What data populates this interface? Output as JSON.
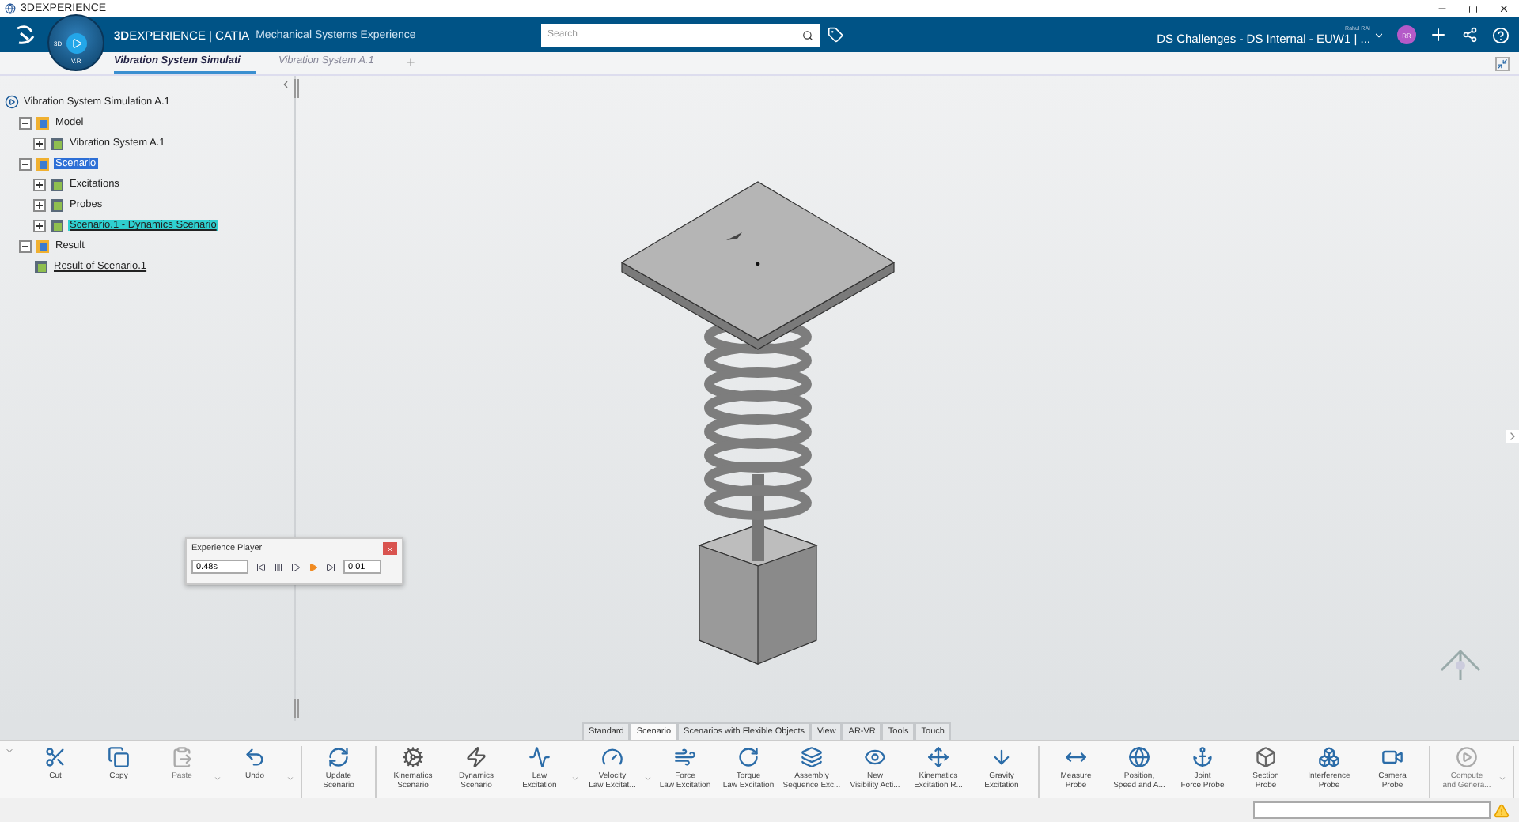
{
  "window": {
    "title": "3DEXPERIENCE"
  },
  "top_bar": {
    "compass_labels": [
      "3D",
      "V.R"
    ],
    "brand": "**3D**EXPERIENCE | CATIA",
    "app": "Mechanical Systems Experience",
    "search": {
      "placeholder": "Search"
    },
    "user": "Rahul RAI",
    "tenant": "DS Challenges - DS Internal - EUW1 | ...",
    "avatar": "RR"
  },
  "tabs": [
    {
      "label": "Vibration System Simulati",
      "selected": true
    },
    {
      "label": "Vibration System A.1",
      "selected": false
    }
  ],
  "tree": {
    "label": "Vibration System Simulation A.1",
    "selected": false,
    "current": false,
    "linked": false,
    "children": [
      {
        "label": "Model",
        "expanded": true,
        "selected": false,
        "current": false,
        "linked": false,
        "children": [
          {
            "label": "Vibration System A.1",
            "expanded": false,
            "selected": false,
            "current": false,
            "linked": false
          }
        ]
      },
      {
        "label": "Scenario",
        "expanded": true,
        "selected": true,
        "current": false,
        "linked": false,
        "children": [
          {
            "label": "Excitations",
            "expanded": false,
            "selected": false,
            "current": false,
            "linked": false
          },
          {
            "label": "Probes",
            "expanded": false,
            "selected": false,
            "current": false,
            "linked": false
          },
          {
            "label": "Scenario.1 - Dynamics Scenario",
            "expanded": false,
            "selected": false,
            "current": true,
            "linked": true
          }
        ]
      },
      {
        "label": "Result",
        "expanded": true,
        "selected": false,
        "current": false,
        "linked": false,
        "children": [
          {
            "label": "Result of Scenario.1",
            "selected": false,
            "current": false,
            "linked": true
          }
        ]
      }
    ]
  },
  "player": {
    "title": "Experience Player",
    "time": "0.48s",
    "step": "0.01"
  },
  "bottom_tabs": [
    {
      "label": "Standard",
      "selected": false
    },
    {
      "label": "Scenario",
      "selected": true
    },
    {
      "label": "Scenarios with Flexible Objects",
      "selected": false
    },
    {
      "label": "View",
      "selected": false
    },
    {
      "label": "AR-VR",
      "selected": false
    },
    {
      "label": "Tools",
      "selected": false
    },
    {
      "label": "Touch",
      "selected": false
    }
  ],
  "toolbar": [
    [
      {
        "lines": [
          "Cut"
        ],
        "disabled": false,
        "dropdown": false
      },
      {
        "lines": [
          "Copy"
        ],
        "disabled": false,
        "dropdown": false
      },
      {
        "lines": [
          "Paste"
        ],
        "disabled": true,
        "dropdown": true
      },
      {
        "lines": [
          "Undo"
        ],
        "disabled": false,
        "dropdown": true
      }
    ],
    [
      {
        "lines": [
          "Update",
          "Scenario"
        ],
        "disabled": false,
        "dropdown": false
      }
    ],
    [
      {
        "lines": [
          "Kinematics",
          "Scenario"
        ],
        "disabled": false,
        "dropdown": false
      },
      {
        "lines": [
          "Dynamics",
          "Scenario"
        ],
        "disabled": false,
        "dropdown": false
      },
      {
        "lines": [
          "Law",
          "Excitation"
        ],
        "disabled": false,
        "dropdown": true
      },
      {
        "lines": [
          "Velocity",
          "Law Excitat..."
        ],
        "disabled": false,
        "dropdown": true
      },
      {
        "lines": [
          "Force",
          "Law Excitation"
        ],
        "disabled": false,
        "dropdown": false
      },
      {
        "lines": [
          "Torque",
          "Law Excitation"
        ],
        "disabled": false,
        "dropdown": false
      },
      {
        "lines": [
          "Assembly",
          "Sequence Exc..."
        ],
        "disabled": false,
        "dropdown": false
      },
      {
        "lines": [
          "New",
          "Visibility Acti..."
        ],
        "disabled": false,
        "dropdown": false
      },
      {
        "lines": [
          "Kinematics",
          "Excitation R..."
        ],
        "disabled": false,
        "dropdown": false
      },
      {
        "lines": [
          "Gravity",
          "Excitation"
        ],
        "disabled": false,
        "dropdown": false
      }
    ],
    [
      {
        "lines": [
          "Measure",
          "Probe"
        ],
        "disabled": false,
        "dropdown": false
      },
      {
        "lines": [
          "Position,",
          "Speed and A..."
        ],
        "disabled": false,
        "dropdown": false
      },
      {
        "lines": [
          "Joint",
          "Force Probe"
        ],
        "disabled": false,
        "dropdown": false
      },
      {
        "lines": [
          "Section",
          "Probe"
        ],
        "disabled": false,
        "dropdown": false
      },
      {
        "lines": [
          "Interference",
          "Probe"
        ],
        "disabled": false,
        "dropdown": false
      },
      {
        "lines": [
          "Camera",
          "Probe"
        ],
        "disabled": false,
        "dropdown": false
      }
    ],
    [
      {
        "lines": [
          "Compute",
          "and Genera..."
        ],
        "disabled": true,
        "dropdown": true
      }
    ]
  ]
}
